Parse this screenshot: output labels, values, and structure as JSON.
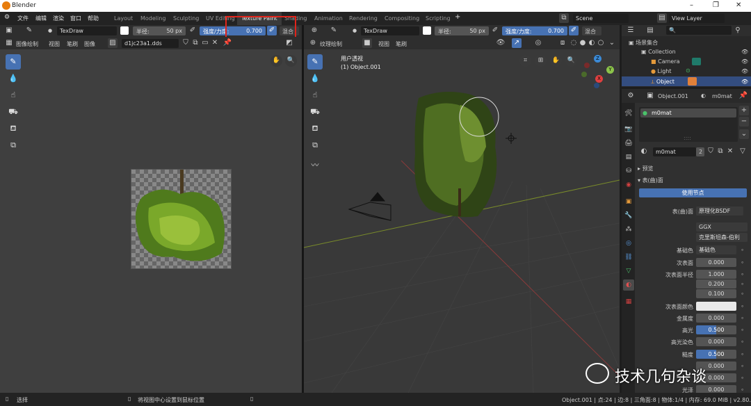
{
  "app": {
    "title": "Blender",
    "controls": [
      "–",
      "❐",
      "✕"
    ]
  },
  "menu": {
    "items": [
      "文件",
      "编辑",
      "渲染",
      "窗口",
      "帮助"
    ]
  },
  "workspaces": {
    "tabs": [
      "Layout",
      "Modeling",
      "Sculpting",
      "UV Editing",
      "Texture Paint",
      "Shading",
      "Animation",
      "Rendering",
      "Compositing",
      "Scripting"
    ],
    "add": "+"
  },
  "scene": {
    "name": "Scene",
    "view_layer": "View Layer"
  },
  "tool_header": {
    "left": {
      "brush": "TexDraw",
      "radius_label": "半径:",
      "radius_value": "50 px",
      "strength_label": "强度/力度:",
      "strength_value": "0.700",
      "blend": "混合"
    },
    "right": {
      "brush": "TexDraw",
      "radius_label": "半径:",
      "radius_value": "50 px",
      "strength_label": "强度/力度:",
      "strength_value": "0.700",
      "blend": "混合"
    }
  },
  "image_editor": {
    "mode": "图像绘制",
    "menus": [
      "视图",
      "笔刷",
      "图像"
    ],
    "image_name": "d1jc23a1.dds"
  },
  "viewport": {
    "mode": "纹理绘制",
    "menus": [
      "视图",
      "笔刷"
    ],
    "overlay_title": "用户透视",
    "overlay_object": "(1) Object.001",
    "gizmo_axes": [
      "Z",
      "Y",
      "X"
    ]
  },
  "outliner": {
    "search_placeholder": "",
    "root": "场景集合",
    "items": [
      "Collection",
      "Camera",
      "Light",
      "Object"
    ]
  },
  "properties": {
    "object_name": "Object.001",
    "material_name": "m0mat",
    "slot": "m0mat",
    "users": "2",
    "sections": {
      "preview": "预览",
      "surface": "表(曲)面"
    },
    "use_nodes": "使用节点",
    "surface_label": "表(曲)面",
    "surface_value": "原理化BSDF",
    "distribution": "GGX",
    "subsurface_method": "克里斯坦森-伯利",
    "rows": [
      {
        "label": "基础色",
        "value": "基础色",
        "kind": "dropdown"
      },
      {
        "label": "次表面",
        "value": "0.000",
        "kind": "num"
      },
      {
        "label": "次表面半径",
        "value": "1.000",
        "kind": "num"
      },
      {
        "label": "",
        "value": "0.200",
        "kind": "num"
      },
      {
        "label": "",
        "value": "0.100",
        "kind": "num"
      },
      {
        "label": "次表面颜色",
        "value": "",
        "kind": "color"
      },
      {
        "label": "金属度",
        "value": "0.000",
        "kind": "num"
      },
      {
        "label": "高光",
        "value": "0.500",
        "kind": "blue"
      },
      {
        "label": "高光染色",
        "value": "0.000",
        "kind": "num"
      },
      {
        "label": "糙度",
        "value": "0.500",
        "kind": "blue"
      },
      {
        "label": "",
        "value": "0.000",
        "kind": "num"
      },
      {
        "label": "",
        "value": "0.000",
        "kind": "num"
      },
      {
        "label": "光泽",
        "value": "0.000",
        "kind": "num"
      }
    ]
  },
  "statusbar": {
    "select": "选择",
    "hint": "将视图中心设置到鼠标位置",
    "info": "Object.001 | 点:24 | 边:8 | 三角面:8 | 物体:1/4 | 内存: 69.0 MiB | v2.80.75"
  },
  "watermark": {
    "text": "技术几句杂谈"
  },
  "colors": {
    "accent": "#4772b3",
    "highlight_box": "#e0241b",
    "header": "#2e2e2e"
  }
}
